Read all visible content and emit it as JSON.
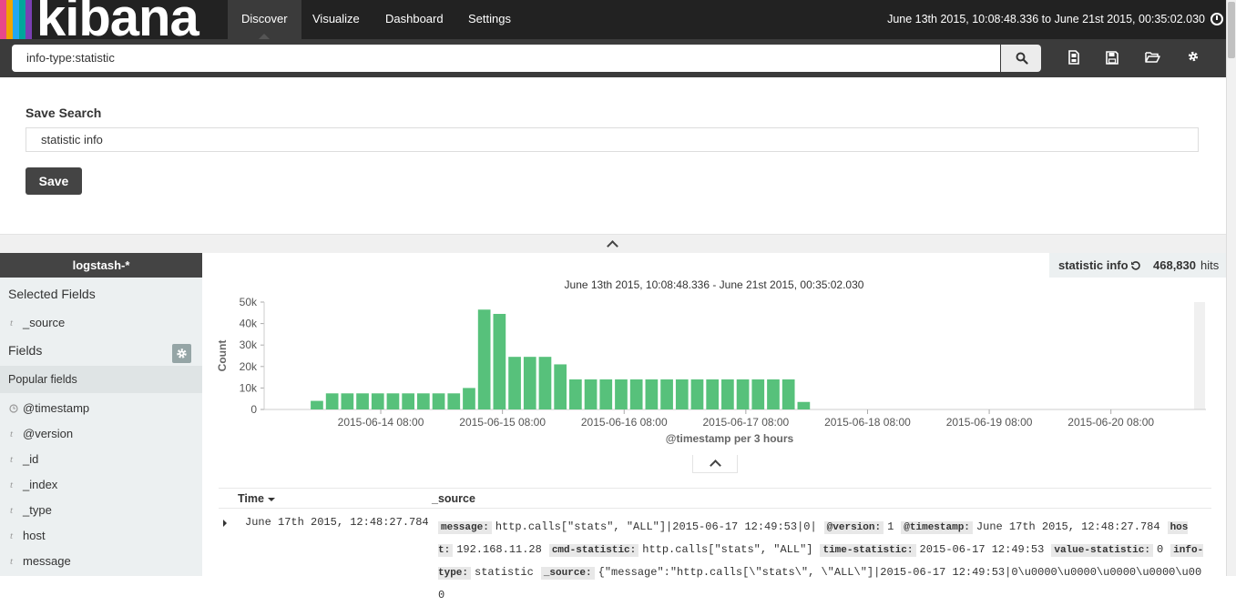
{
  "app": {
    "logo_text": "kibana",
    "logo_colors": [
      "#e8488b",
      "#f0a500",
      "#22a7f0",
      "#00a69b",
      "#7a3fb3"
    ]
  },
  "nav": {
    "tabs": [
      {
        "label": "Discover",
        "active": true
      },
      {
        "label": "Visualize",
        "active": false
      },
      {
        "label": "Dashboard",
        "active": false
      },
      {
        "label": "Settings",
        "active": false
      }
    ],
    "time_range": "June 13th 2015, 10:08:48.336 to June 21st 2015, 00:35:02.030"
  },
  "search": {
    "query": "info-type:statistic"
  },
  "toolbar": {
    "icons": [
      "new-search-icon",
      "save-icon",
      "open-folder-icon",
      "gear-icon"
    ]
  },
  "save_panel": {
    "label": "Save Search",
    "name_value": "statistic info",
    "save_button": "Save"
  },
  "sidebar": {
    "index_pattern": "logstash-*",
    "selected_fields_heading": "Selected Fields",
    "selected_fields": [
      {
        "type": "t",
        "name": "_source"
      }
    ],
    "fields_heading": "Fields",
    "popular_heading": "Popular fields",
    "popular_fields": [
      {
        "type": "clock",
        "name": "@timestamp"
      },
      {
        "type": "t",
        "name": "@version"
      },
      {
        "type": "t",
        "name": "_id"
      },
      {
        "type": "t",
        "name": "_index"
      },
      {
        "type": "t",
        "name": "_type"
      },
      {
        "type": "t",
        "name": "host"
      },
      {
        "type": "t",
        "name": "message"
      }
    ]
  },
  "hits": {
    "search_name": "statistic info",
    "count": "468,830",
    "suffix": "hits"
  },
  "chart_data": {
    "type": "bar",
    "title": "June 13th 2015, 10:08:48.336 - June 21st 2015, 00:35:02.030",
    "xlabel": "@timestamp per 3 hours",
    "ylabel": "Count",
    "ylim": [
      0,
      50000
    ],
    "yticks": [
      0,
      10000,
      20000,
      30000,
      40000,
      50000
    ],
    "ytick_labels": [
      "0",
      "10k",
      "20k",
      "30k",
      "40k",
      "50k"
    ],
    "x_start": "2015-06-13 09:00",
    "x_end": "2015-06-21 00:35",
    "xtick_labels": [
      "2015-06-14 08:00",
      "2015-06-15 08:00",
      "2015-06-16 08:00",
      "2015-06-17 08:00",
      "2015-06-18 08:00",
      "2015-06-19 08:00",
      "2015-06-20 08:00"
    ],
    "bar_interval": "3 hours",
    "color": "#57c17b",
    "x": [
      "2015-06-13 18:00",
      "2015-06-13 21:00",
      "2015-06-14 00:00",
      "2015-06-14 03:00",
      "2015-06-14 06:00",
      "2015-06-14 09:00",
      "2015-06-14 12:00",
      "2015-06-14 15:00",
      "2015-06-14 18:00",
      "2015-06-14 21:00",
      "2015-06-15 00:00",
      "2015-06-15 03:00",
      "2015-06-15 06:00",
      "2015-06-15 09:00",
      "2015-06-15 12:00",
      "2015-06-15 15:00",
      "2015-06-15 18:00",
      "2015-06-15 21:00",
      "2015-06-16 00:00",
      "2015-06-16 03:00",
      "2015-06-16 06:00",
      "2015-06-16 09:00",
      "2015-06-16 12:00",
      "2015-06-16 15:00",
      "2015-06-16 18:00",
      "2015-06-16 21:00",
      "2015-06-17 00:00",
      "2015-06-17 03:00",
      "2015-06-17 06:00",
      "2015-06-17 09:00",
      "2015-06-17 12:00",
      "2015-06-17 15:00",
      "2015-06-17 18:00"
    ],
    "values": [
      4000,
      7500,
      7500,
      7500,
      7500,
      7500,
      7500,
      7500,
      7500,
      7500,
      10000,
      46500,
      44500,
      24500,
      24500,
      24500,
      21000,
      14000,
      14000,
      14000,
      14000,
      14000,
      14000,
      14000,
      14000,
      14000,
      14000,
      14000,
      14000,
      14000,
      14000,
      14000,
      3500
    ]
  },
  "table": {
    "headers": [
      "Time",
      "_source"
    ],
    "row": {
      "time": "June 17th 2015, 12:48:27.784",
      "source": [
        {
          "key": "message:",
          "value": "http.calls[\"stats\", \"ALL\"]|2015-06-17 12:49:53|0|"
        },
        {
          "key": "@version:",
          "value": "1"
        },
        {
          "key": "@timestamp:",
          "value": "June 17th 2015, 12:48:27.784"
        },
        {
          "key": "host:",
          "value": "192.168.11.28"
        },
        {
          "key": "cmd-statistic:",
          "value": "http.calls[\"stats\", \"ALL\"]"
        },
        {
          "key": "time-statistic:",
          "value": "2015-06-17 12:49:53"
        },
        {
          "key": "value-statistic:",
          "value": "0"
        },
        {
          "key": "info-type:",
          "value": "statistic"
        },
        {
          "key": "_source:",
          "value": "{\"message\":\"http.calls[\\\"stats\\\", \\\"ALL\\\"]|2015-06-17 12:49:53|0\\u0000\\u0000\\u0000\\u0000\\u000"
        }
      ]
    }
  }
}
